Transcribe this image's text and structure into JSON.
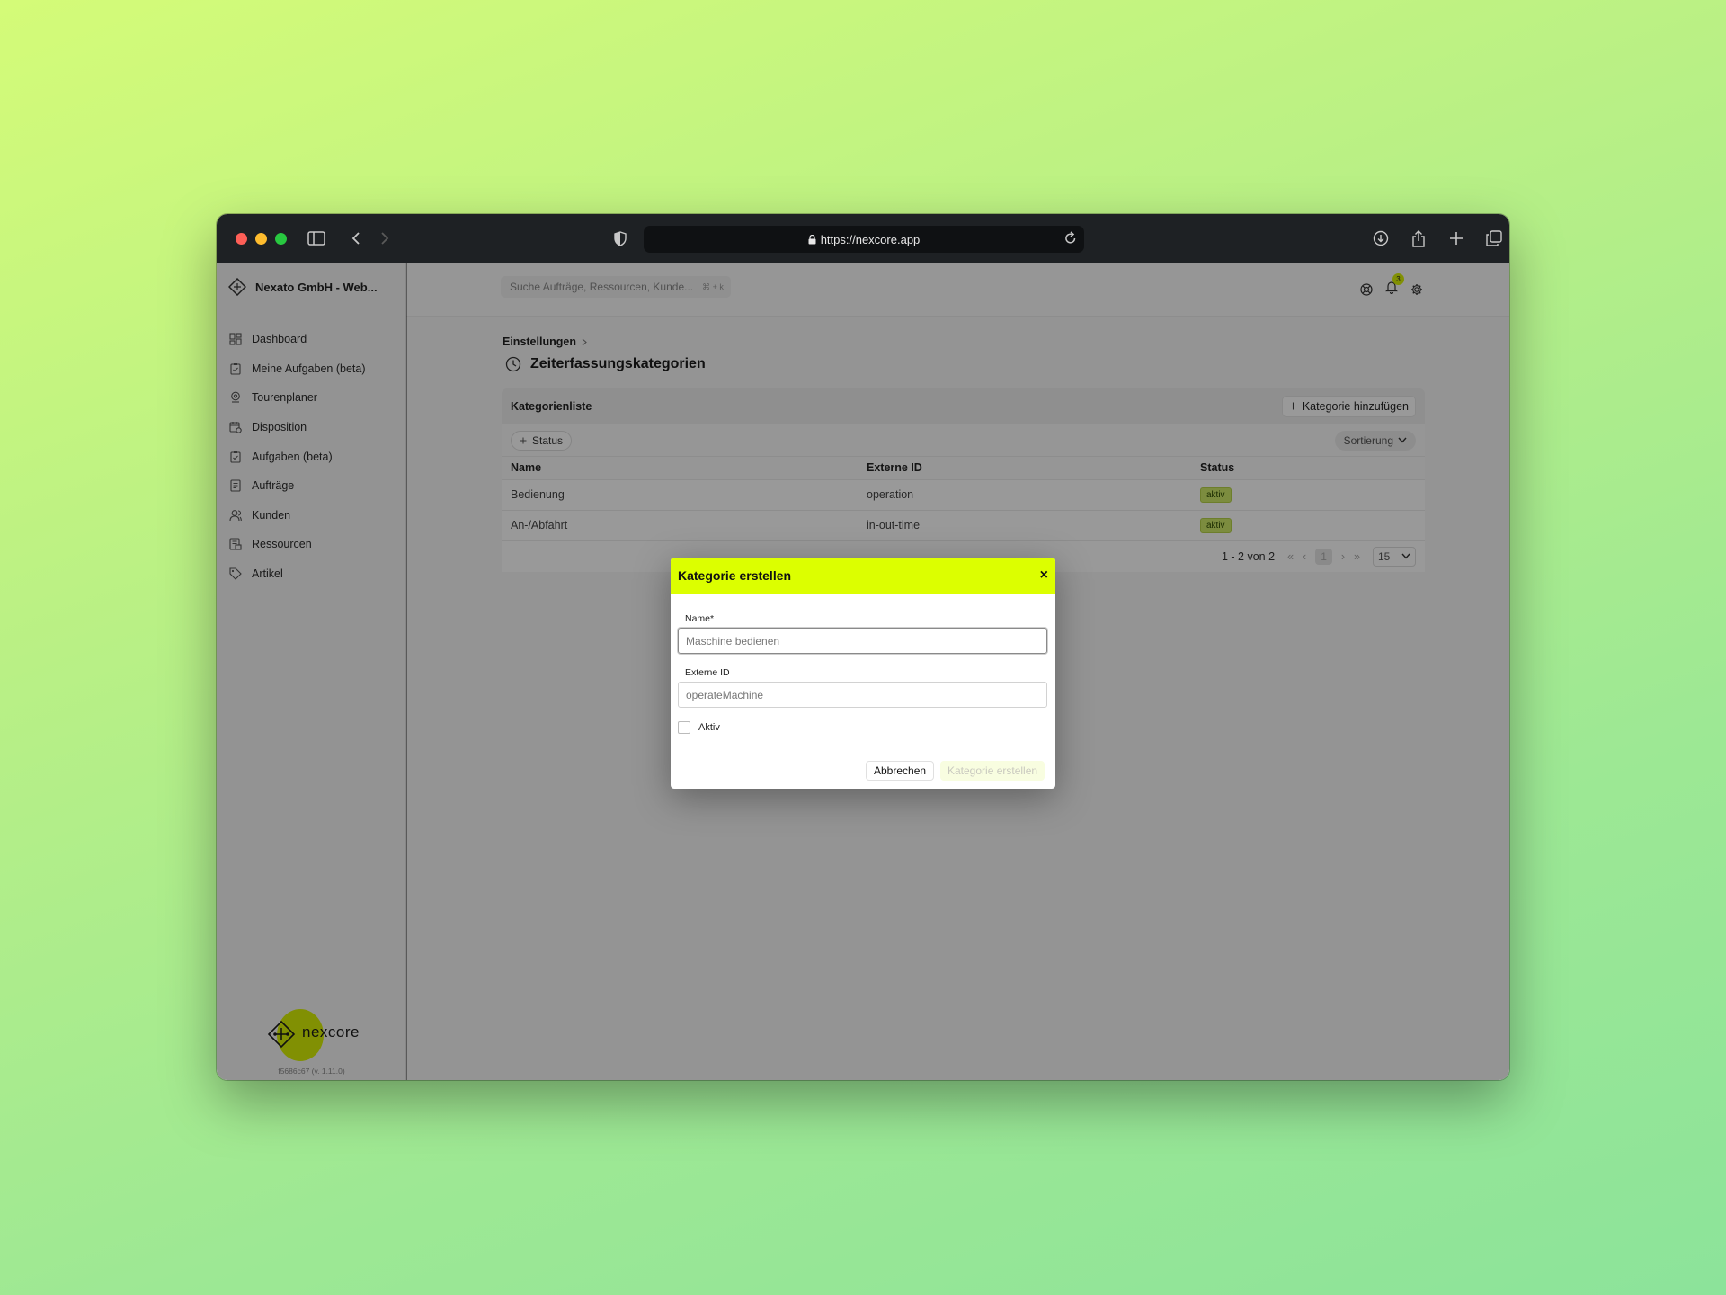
{
  "browser": {
    "url": "https://nexcore.app"
  },
  "sidebar": {
    "workspace": "Nexato GmbH - Web...",
    "items": [
      {
        "label": "Dashboard",
        "icon": "dashboard-icon"
      },
      {
        "label": "Meine Aufgaben (beta)",
        "icon": "clipboard-icon"
      },
      {
        "label": "Tourenplaner",
        "icon": "map-pin-icon"
      },
      {
        "label": "Disposition",
        "icon": "calendar-icon"
      },
      {
        "label": "Aufgaben (beta)",
        "icon": "clipboard-icon"
      },
      {
        "label": "Aufträge",
        "icon": "document-icon"
      },
      {
        "label": "Kunden",
        "icon": "users-icon"
      },
      {
        "label": "Ressourcen",
        "icon": "resource-icon"
      },
      {
        "label": "Artikel",
        "icon": "tag-icon"
      }
    ],
    "logo_text": "nexcore",
    "version": "f5686c67 (v. 1.11.0)"
  },
  "topbar": {
    "search_placeholder": "Suche Aufträge, Ressourcen, Kunde...",
    "search_shortcut": "⌘ + k",
    "notification_count": "3"
  },
  "breadcrumb": {
    "item": "Einstellungen"
  },
  "page": {
    "title": "Zeiterfassungskategorien"
  },
  "card": {
    "title": "Kategorienliste",
    "add_label": "Kategorie hinzufügen",
    "filter_label": "Status",
    "sort_label": "Sortierung",
    "columns": [
      "Name",
      "Externe ID",
      "Status"
    ],
    "rows": [
      {
        "name": "Bedienung",
        "external_id": "operation",
        "status": "aktiv"
      },
      {
        "name": "An-/Abfahrt",
        "external_id": "in-out-time",
        "status": "aktiv"
      }
    ],
    "pagination": {
      "range": "1 - 2 von 2",
      "current_page": "1",
      "per_page": "15"
    }
  },
  "modal": {
    "title": "Kategorie erstellen",
    "name_label": "Name*",
    "name_placeholder": "Maschine bedienen",
    "external_id_label": "Externe ID",
    "external_id_placeholder": "operateMachine",
    "active_label": "Aktiv",
    "cancel_label": "Abbrechen",
    "create_label": "Kategorie erstellen"
  },
  "colors": {
    "accent": "#dcff00",
    "status_pill": "#cfe96a",
    "titlebar": "#1e2124"
  }
}
